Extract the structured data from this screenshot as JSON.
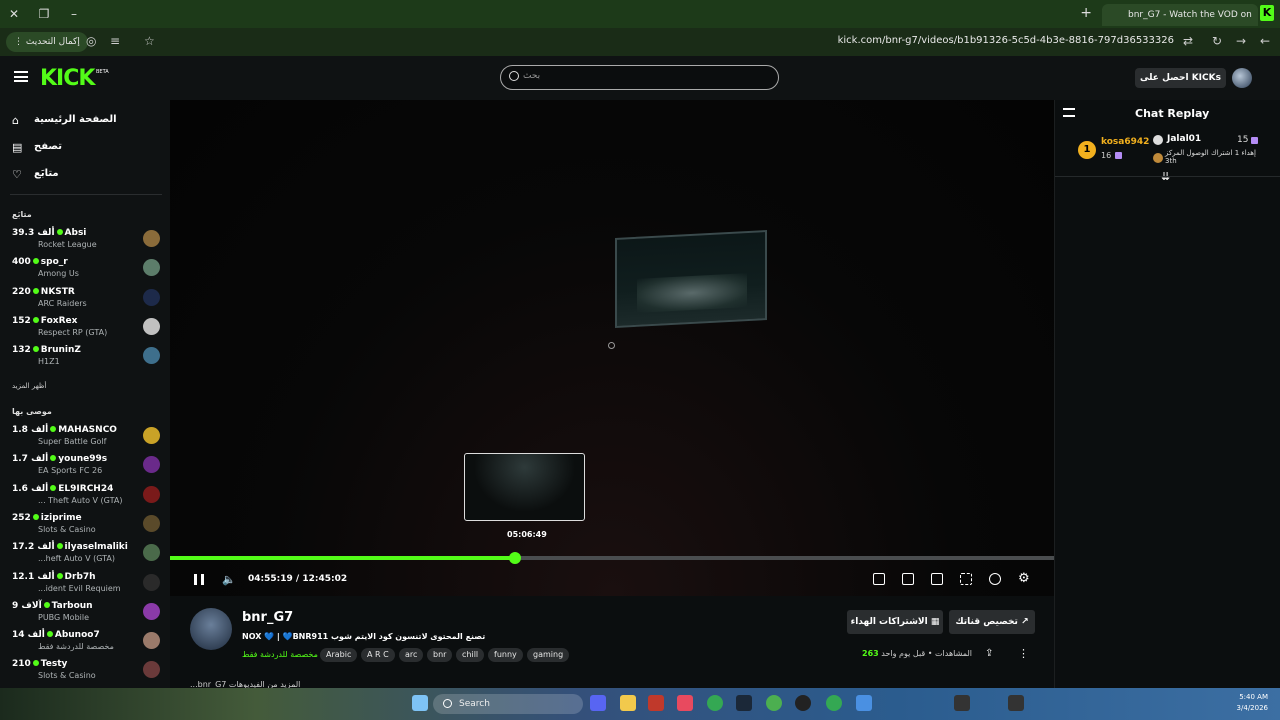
{
  "window": {
    "tab_title": "bnr_G7 - Watch the VOD on",
    "close_symbol": "✕",
    "new_tab_symbol": "+",
    "favicon_letter": "K"
  },
  "addressbar": {
    "update_label": "إكمال التحديث",
    "url": "kick.com/bnr-g7/videos/b1b91326-5c5d-4b3e-8816-797d36533326"
  },
  "header": {
    "logo": "KICK",
    "logo_badge": "BETA",
    "search_placeholder": "بحث",
    "get_kicks_label": "احصل على KICKs"
  },
  "sidebar": {
    "nav": [
      {
        "label": "الصفحة الرئيسية",
        "icon": "home-icon"
      },
      {
        "label": "تصفح",
        "icon": "browse-icon"
      },
      {
        "label": "متابَع",
        "icon": "heart-icon"
      }
    ],
    "following_title": "متابَع",
    "following": [
      {
        "views": "39.3 ألف",
        "name": "Absi",
        "game": "Rocket League",
        "avatar_color": "#8a6b3a"
      },
      {
        "views": "400",
        "name": "spo_r",
        "game": "Among Us",
        "avatar_color": "#5c7d6a"
      },
      {
        "views": "220",
        "name": "NKSTR",
        "game": "ARC Raiders",
        "avatar_color": "#1d2a4a"
      },
      {
        "views": "152",
        "name": "FoxRex",
        "game": "Respect RP (GTA)",
        "avatar_color": "#c0c0c0"
      },
      {
        "views": "132",
        "name": "BruninZ",
        "game": "H1Z1",
        "avatar_color": "#3e6f8c"
      }
    ],
    "show_more": "أظهر المزيد",
    "recommended_title": "موصى بها",
    "recommended": [
      {
        "views": "1.8 ألف",
        "name": "MAHASNCO",
        "game": "Super Battle Golf",
        "avatar_color": "#c9a227"
      },
      {
        "views": "1.7 ألف",
        "name": "youne99s",
        "game": "EA Sports FC 26",
        "avatar_color": "#6a2a8a"
      },
      {
        "views": "1.6 ألف",
        "name": "EL9IRCH24",
        "game": "... Theft Auto V (GTA)",
        "avatar_color": "#7a1a1a"
      },
      {
        "views": "252",
        "name": "iziprime",
        "game": "Slots & Casino",
        "avatar_color": "#5a4a2a"
      },
      {
        "views": "17.2 ألف",
        "name": "ilyaselmaliki",
        "game": "...heft Auto V (GTA)",
        "avatar_color": "#4a6a4a"
      },
      {
        "views": "12.1 ألف",
        "name": "Drb7h",
        "game": "...ident Evil Requiem",
        "avatar_color": "#2a2a2a"
      },
      {
        "views": "9 آلاف",
        "name": "Tarboun",
        "game": "PUBG Mobile",
        "avatar_color": "#8a3aa8"
      },
      {
        "views": "14 ألف",
        "name": "Abunoo7",
        "game": "مخصصة للدردشة فقط",
        "avatar_color": "#9a7a6a"
      },
      {
        "views": "210",
        "name": "Testy",
        "game": "Slots & Casino",
        "avatar_color": "#6a3a3a"
      }
    ]
  },
  "player": {
    "preview_time": "05:06:49",
    "current_time": "04:55:19",
    "duration": "12:45:02",
    "time_separator": "/",
    "progress_fraction": 0.39
  },
  "chat": {
    "title": "Chat Replay",
    "entries": [
      {
        "rank": "1",
        "user": "kosa6942",
        "months": "16"
      },
      {
        "user": "Jalal01",
        "count": "15",
        "message": "إهداء 1 اشتراك الوصول المركز",
        "rank_text": "3th"
      }
    ]
  },
  "info": {
    "streamer": "bnr_G7",
    "title": "NOX 💙 | 💙BNR911 تصنع المحتوى لاتنسون كود الايتم شوب",
    "chat_only": "مخصصة للدردشة فقط",
    "tags": [
      "Arabic",
      "A R C",
      "arc",
      "bnr",
      "chill",
      "funny",
      "gaming"
    ],
    "gift_label": "الاشتراكات الهداء",
    "customize_label": "تخصيص قناتك",
    "views_count": "263",
    "views_label": "المشاهدات",
    "ago": "قبل يوم واحد",
    "more_below": "...bnr_G7 المزيد من الفيديوهات"
  },
  "taskbar": {
    "search": "Search",
    "time": "5:40 AM",
    "date": "3/4/2026"
  },
  "colors": {
    "accent": "#53fc18",
    "bg": "#0b0e0f"
  }
}
